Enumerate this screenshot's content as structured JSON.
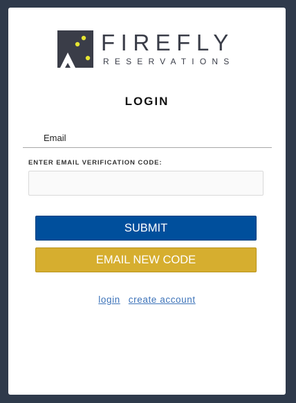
{
  "brand": {
    "name": "FIREFLY",
    "tagline": "RESERVATIONS",
    "colors": {
      "dark": "#3a3d48",
      "dots": "#e6e532"
    }
  },
  "login": {
    "title": "LOGIN",
    "email_label": "Email",
    "code_label": "ENTER EMAIL VERIFICATION CODE:",
    "code_value": "",
    "submit_label": "SUBMIT",
    "new_code_label": "EMAIL NEW CODE"
  },
  "links": {
    "login": "login",
    "create_account": "create account"
  },
  "colors": {
    "background": "#2f3a4b",
    "submit": "#004f9c",
    "new_code": "#d6ae2f",
    "link": "#3d73b9"
  }
}
